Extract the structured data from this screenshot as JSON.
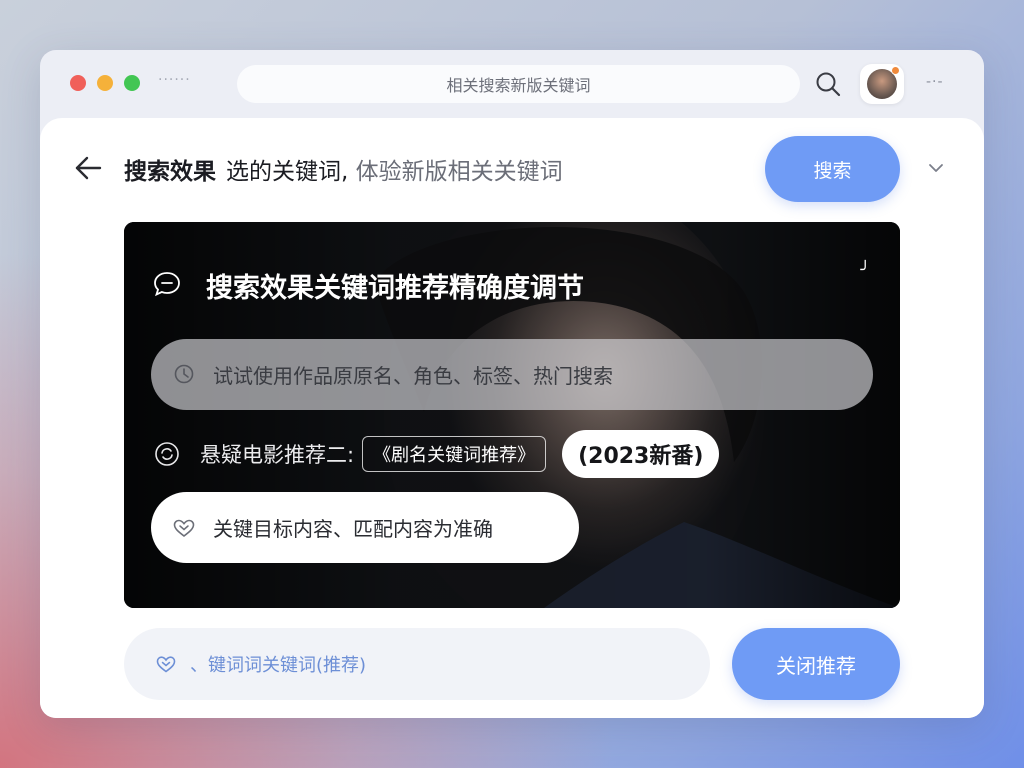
{
  "window": {
    "address": "相关搜索新版关键词"
  },
  "header": {
    "title": "搜索效果",
    "subtitle": "选的关键词,",
    "hint": "体验新版相关关键词",
    "primary_button": "搜索"
  },
  "hero": {
    "title": "搜索效果关键词推荐精确度调节",
    "search_placeholder": "试试使用作品原原名、角色、标签、热门搜索",
    "suggest_label": "悬疑电影推荐二:",
    "suggest_tag": "《剧名关键词推荐》",
    "suggest_year": "(2023新番)",
    "pill_text": "关键目标内容、匹配内容为准确"
  },
  "footer": {
    "input_text": "、键词词关键词(推荐)",
    "button_label": "关闭推荐"
  },
  "colors": {
    "accent": "#6f9bf5",
    "window_bg": "#eceef5",
    "hero_bg": "#0d0f12"
  },
  "icons": [
    "search-icon",
    "avatar",
    "more-icon",
    "back-arrow-icon",
    "chevron-down-icon",
    "chat-icon",
    "clock-icon",
    "refresh-icon",
    "heart-icon"
  ]
}
